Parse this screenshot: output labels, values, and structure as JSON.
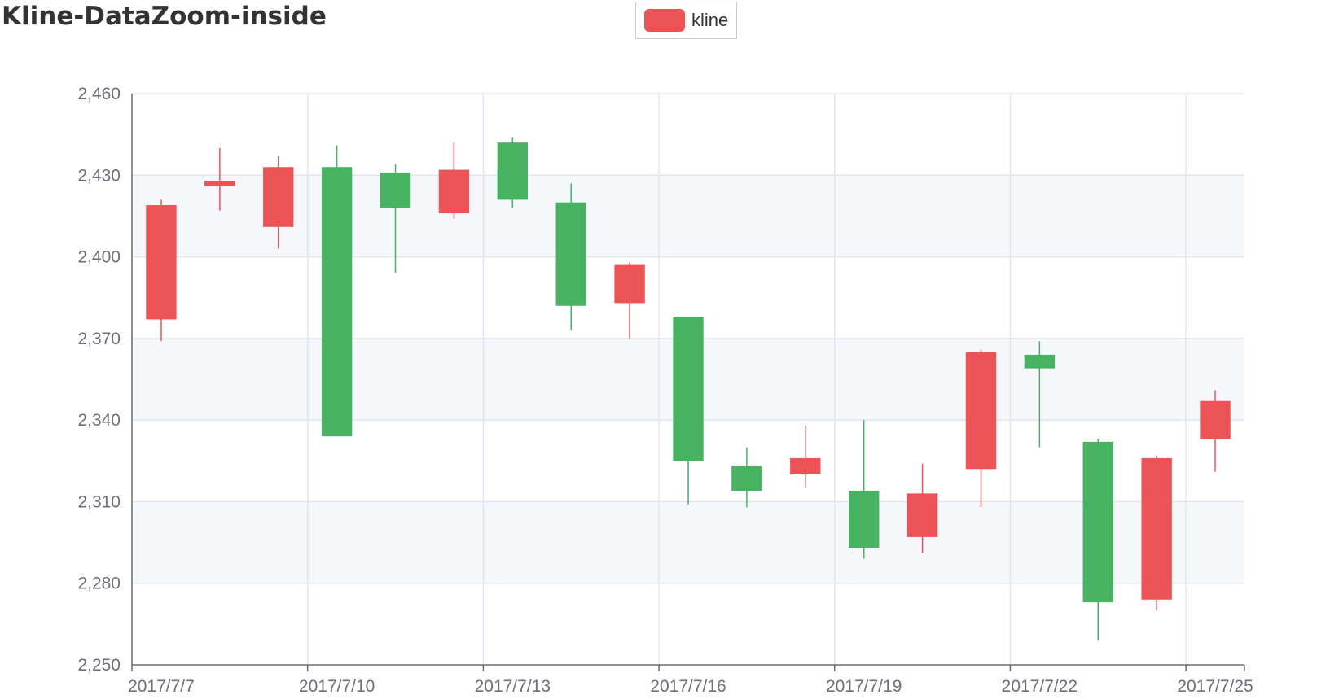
{
  "chart_data": {
    "type": "candlestick",
    "title": "Kline-DataZoom-inside",
    "legend": {
      "entries": [
        "kline"
      ],
      "placement": "top-center"
    },
    "colors": {
      "up": "#ec5357",
      "down": "#47b262",
      "grid": "#e0e6f1",
      "band": "#f6f7fb",
      "axis": "#6e7079"
    },
    "x": [
      "2017/7/7",
      "2017/7/8",
      "2017/7/9",
      "2017/7/10",
      "2017/7/11",
      "2017/7/12",
      "2017/7/13",
      "2017/7/14",
      "2017/7/15",
      "2017/7/16",
      "2017/7/17",
      "2017/7/18",
      "2017/7/19",
      "2017/7/20",
      "2017/7/21",
      "2017/7/22",
      "2017/7/23",
      "2017/7/24",
      "2017/7/25"
    ],
    "x_tick_labels": [
      "2017/7/7",
      "2017/7/10",
      "2017/7/13",
      "2017/7/16",
      "2017/7/19",
      "2017/7/22",
      "2017/7/25"
    ],
    "ohlc": [
      [
        2377,
        2419,
        2369,
        2421
      ],
      [
        2426,
        2428,
        2417,
        2440
      ],
      [
        2411,
        2433,
        2403,
        2437
      ],
      [
        2433,
        2334,
        2334,
        2441
      ],
      [
        2431,
        2418,
        2394,
        2434
      ],
      [
        2416,
        2432,
        2414,
        2442
      ],
      [
        2442,
        2421,
        2418,
        2444
      ],
      [
        2420,
        2382,
        2373,
        2427
      ],
      [
        2383,
        2397,
        2370,
        2398
      ],
      [
        2378,
        2325,
        2309,
        2378
      ],
      [
        2323,
        2314,
        2308,
        2330
      ],
      [
        2320,
        2326,
        2315,
        2338
      ],
      [
        2314,
        2293,
        2289,
        2340
      ],
      [
        2297,
        2313,
        2291,
        2324
      ],
      [
        2322,
        2365,
        2308,
        2366
      ],
      [
        2364,
        2359,
        2330,
        2369
      ],
      [
        2332,
        2273,
        2259,
        2333
      ],
      [
        2274,
        2326,
        2270,
        2327
      ],
      [
        2333,
        2347,
        2321,
        2351
      ]
    ],
    "ylim": [
      2250,
      2460
    ],
    "y_ticks": [
      2250,
      2280,
      2310,
      2340,
      2370,
      2400,
      2430,
      2460
    ],
    "y_tick_labels": [
      "2,250",
      "2,280",
      "2,310",
      "2,340",
      "2,370",
      "2,400",
      "2,430",
      "2,460"
    ],
    "grid": true
  }
}
